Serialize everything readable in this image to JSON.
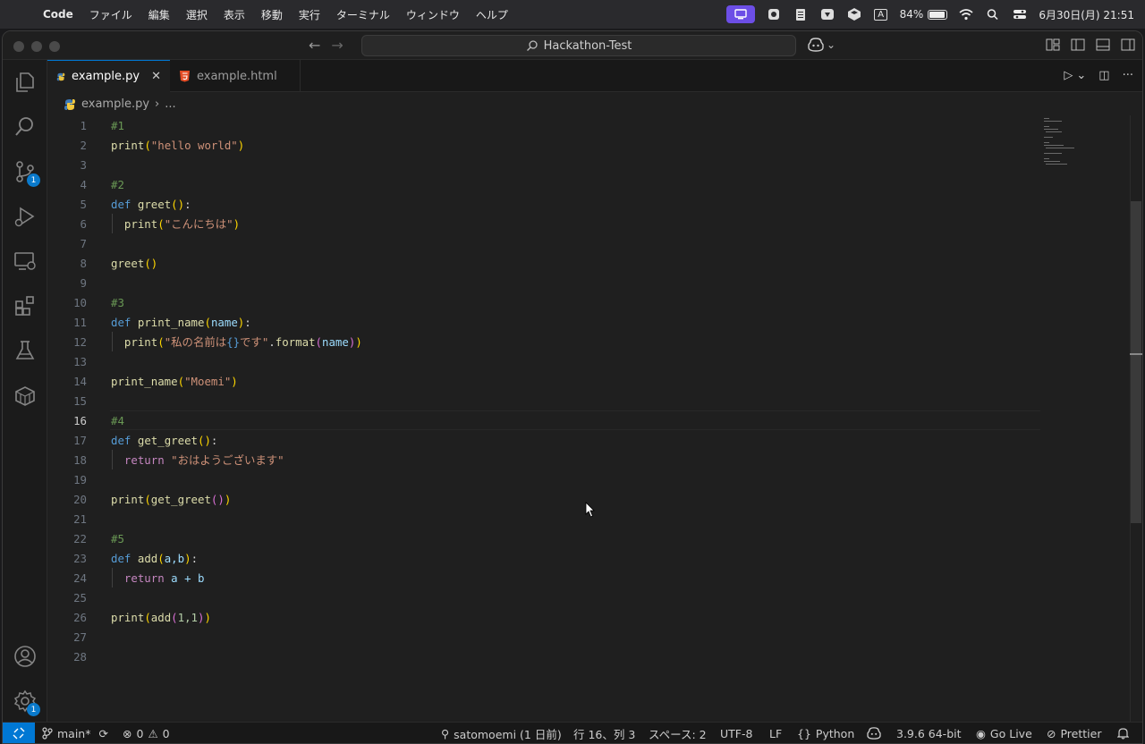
{
  "menubar": {
    "app_name": "Code",
    "items": [
      "ファイル",
      "編集",
      "選択",
      "表示",
      "移動",
      "実行",
      "ターミナル",
      "ウィンドウ",
      "ヘルプ"
    ],
    "input_indicator": "A",
    "battery_percent": "84%",
    "battery_level": 0.84,
    "datetime": "6月30日(月)  21:51"
  },
  "titlebar": {
    "search_text": "Hackathon-Test"
  },
  "tabs": [
    {
      "label": "example.py",
      "active": true
    },
    {
      "label": "example.html",
      "active": false
    }
  ],
  "breadcrumb": {
    "file": "example.py",
    "rest": "..."
  },
  "activity_bar": {
    "source_control_badge": "1",
    "settings_badge": "1"
  },
  "editor": {
    "current_line": 16,
    "lines": [
      {
        "n": "1"
      },
      {
        "n": "2"
      },
      {
        "n": "3"
      },
      {
        "n": "4"
      },
      {
        "n": "5"
      },
      {
        "n": "6"
      },
      {
        "n": "7"
      },
      {
        "n": "8"
      },
      {
        "n": "9"
      },
      {
        "n": "10"
      },
      {
        "n": "11"
      },
      {
        "n": "12"
      },
      {
        "n": "13"
      },
      {
        "n": "14"
      },
      {
        "n": "15"
      },
      {
        "n": "16"
      },
      {
        "n": "17"
      },
      {
        "n": "18"
      },
      {
        "n": "19"
      },
      {
        "n": "20"
      },
      {
        "n": "21"
      },
      {
        "n": "22"
      },
      {
        "n": "23"
      },
      {
        "n": "24"
      },
      {
        "n": "25"
      },
      {
        "n": "26"
      },
      {
        "n": "27"
      },
      {
        "n": "28"
      }
    ],
    "code": {
      "l1": "#1",
      "l2_fn": "print",
      "l2_str": "\"hello world\"",
      "l4": "#2",
      "l5_kw": "def",
      "l5_fn": "greet",
      "l6_fn": "print",
      "l6_str": "\"こんにちは\"",
      "l8_fn": "greet",
      "l10": "#3",
      "l11_kw": "def",
      "l11_fn": "print_name",
      "l11_param": "name",
      "l12_fn": "print",
      "l12_str1": "\"私の名前は",
      "l12_brace": "{}",
      "l12_str2": "です\"",
      "l12_method": "format",
      "l12_arg": "name",
      "l14_fn": "print_name",
      "l14_str": "\"Moemi\"",
      "l16": "#4",
      "l17_kw": "def",
      "l17_fn": "get_greet",
      "l18_kw": "return",
      "l18_str": "\"おはようございます\"",
      "l20_fn": "print",
      "l20_fn2": "get_greet",
      "l22": "#5",
      "l23_kw": "def",
      "l23_fn": "add",
      "l23_params": "a,b",
      "l24_kw": "return",
      "l24_expr": "a + b",
      "l26_fn": "print",
      "l26_fn2": "add",
      "l26_args": "1,1"
    }
  },
  "statusbar": {
    "branch": "main*",
    "errors": "0",
    "warnings": "0",
    "blame": "satomoemi (1 日前)",
    "position": "行 16、列 3",
    "spaces": "スペース: 2",
    "encoding": "UTF-8",
    "eol": "LF",
    "language": "Python",
    "interpreter": "3.9.6 64-bit",
    "go_live": "Go Live",
    "prettier": "Prettier"
  },
  "colors": {
    "accent": "#0078d4",
    "keyword": "#569cd6",
    "function": "#dcdcaa",
    "string": "#ce9178",
    "comment": "#6a9955"
  }
}
